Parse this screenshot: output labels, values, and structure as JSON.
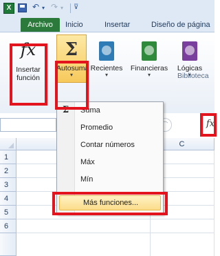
{
  "ribbon": {
    "tabs": [
      {
        "label": "Archivo"
      },
      {
        "label": "Inicio"
      },
      {
        "label": "Insertar"
      },
      {
        "label": "Diseño de página"
      }
    ],
    "buttons": {
      "insert_function": {
        "line1": "Insertar",
        "line2": "función",
        "icon": "fx-icon"
      },
      "autosum": {
        "label": "Autosuma",
        "icon": "sigma-icon"
      },
      "recent": {
        "label": "Recientes",
        "icon": "star-book-icon",
        "color": "#2e7bb5"
      },
      "financial": {
        "label": "Financieras",
        "icon": "money-book-icon",
        "color": "#2f8a3c"
      },
      "logical": {
        "label": "Lógicas",
        "icon": "question-book-icon",
        "color": "#7a3f9c"
      }
    },
    "group_label": "Biblioteca"
  },
  "formula_bar": {
    "fx_label": "fx"
  },
  "grid": {
    "columns": [
      "C"
    ],
    "rows": [
      "1",
      "2",
      "3",
      "4",
      "5",
      "6"
    ]
  },
  "dropdown": {
    "items": [
      {
        "label": "Suma",
        "icon": "sigma-icon"
      },
      {
        "label": "Promedio"
      },
      {
        "label": "Contar números"
      },
      {
        "label": "Máx"
      },
      {
        "label": "Mín"
      },
      {
        "label": "Más funciones..."
      }
    ]
  },
  "colors": {
    "highlight": "#e3141e",
    "file_tab": "#2b7a3c",
    "hover": "#fbdc8a"
  }
}
